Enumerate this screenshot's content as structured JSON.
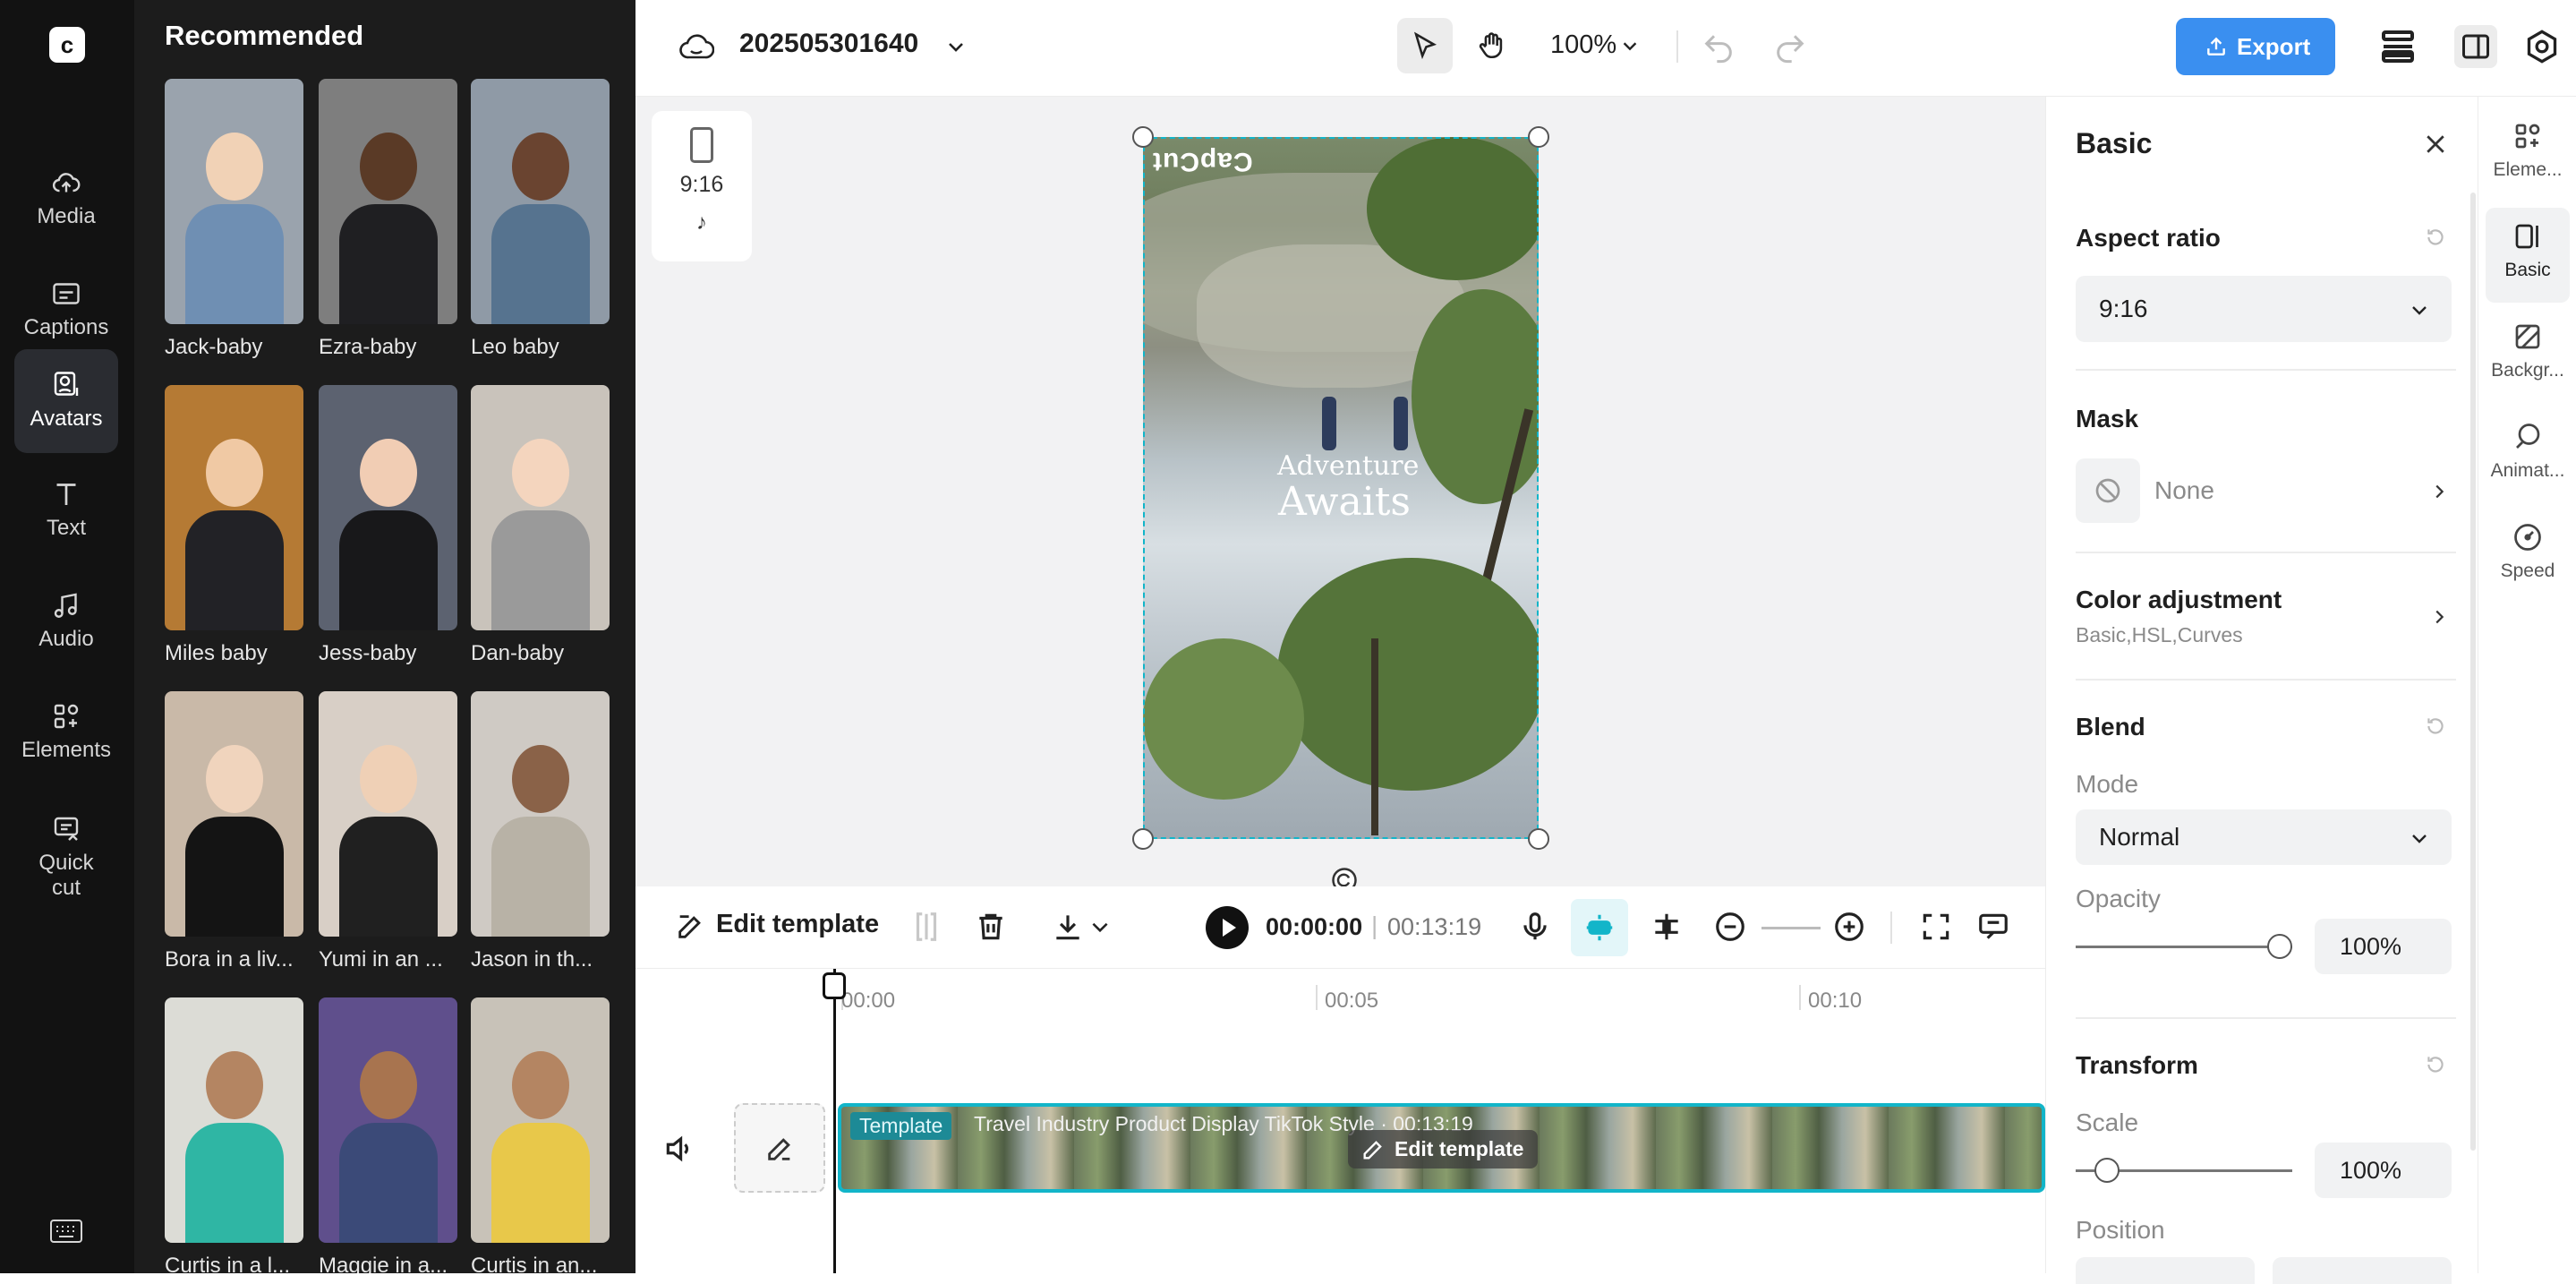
{
  "sidebar": {
    "items": [
      {
        "label": "Media",
        "icon": "cloud-upload-icon"
      },
      {
        "label": "Captions",
        "icon": "captions-icon"
      },
      {
        "label": "Avatars",
        "icon": "avatar-icon"
      },
      {
        "label": "Text",
        "icon": "text-icon"
      },
      {
        "label": "Audio",
        "icon": "music-note-icon"
      },
      {
        "label": "Elements",
        "icon": "elements-icon"
      },
      {
        "label": "Quick\ncut",
        "icon": "quick-cut-icon"
      }
    ],
    "active": "Avatars"
  },
  "panel": {
    "title": "Recommended",
    "avatars": [
      {
        "name": "Jack-baby",
        "bg": "#9aa3ad",
        "skin": "#f1d2b6",
        "cloth": "#6f8fb3"
      },
      {
        "name": "Ezra-baby",
        "bg": "#7e7e7e",
        "skin": "#5a3a26",
        "cloth": "#1f1f22"
      },
      {
        "name": "Leo baby",
        "bg": "#8f9aa6",
        "skin": "#6a4430",
        "cloth": "#56738f"
      },
      {
        "name": "Miles baby",
        "bg": "#b57a34",
        "skin": "#f0c9a4",
        "cloth": "#222226"
      },
      {
        "name": "Jess-baby",
        "bg": "#5c6270",
        "skin": "#f1cdb4",
        "cloth": "#18181a"
      },
      {
        "name": "Dan-baby",
        "bg": "#c9c3bb",
        "skin": "#f4d5be",
        "cloth": "#9a9a9a"
      },
      {
        "name": "Bora in a liv...",
        "bg": "#c9b9a8",
        "skin": "#f0d4bd",
        "cloth": "#141414"
      },
      {
        "name": "Yumi in an ...",
        "bg": "#d8cfc6",
        "skin": "#efd0b6",
        "cloth": "#202020"
      },
      {
        "name": "Jason in th...",
        "bg": "#cfcac4",
        "skin": "#8a6248",
        "cloth": "#b8b2a6"
      },
      {
        "name": "Curtis in a l...",
        "bg": "#dcdcd6",
        "skin": "#b48562",
        "cloth": "#2fb6a4"
      },
      {
        "name": "Maggie in a...",
        "bg": "#5f4f8c",
        "skin": "#a8744f",
        "cloth": "#3b4a78"
      },
      {
        "name": "Curtis in an...",
        "bg": "#c8c2b8",
        "skin": "#b48562",
        "cloth": "#e8c84a"
      }
    ]
  },
  "topbar": {
    "project_name": "202505301640",
    "zoom": "100%",
    "export_label": "Export",
    "accent": "#3a8ff0"
  },
  "canvas": {
    "ratio_label": "9:16",
    "logo_text": "CapCut",
    "title_line1": "Adventure",
    "title_line2": "Awaits"
  },
  "timeline_toolbar": {
    "edit_template_label": "Edit template",
    "current_time": "00:00:00",
    "separator": "|",
    "total_time": "00:13:19"
  },
  "timeline": {
    "ruler": [
      "00:00",
      "00:05",
      "00:10"
    ],
    "clip_tag": "Template",
    "clip_title": "Travel Industry Product Display TikTok Style · 00:13:19",
    "clip_edit_label": "Edit template",
    "selection_color": "#12b5c9"
  },
  "properties": {
    "title": "Basic",
    "aspect_ratio": {
      "label": "Aspect ratio",
      "value": "9:16"
    },
    "mask": {
      "label": "Mask",
      "value": "None"
    },
    "color_adjustment": {
      "label": "Color adjustment",
      "sub": "Basic,HSL,Curves"
    },
    "blend": {
      "label": "Blend",
      "mode_label": "Mode",
      "mode_value": "Normal",
      "opacity_label": "Opacity",
      "opacity_value": "100%",
      "opacity_fraction": 1.0
    },
    "transform": {
      "label": "Transform",
      "scale_label": "Scale",
      "scale_value": "100%",
      "scale_fraction": 0.1,
      "position_label": "Position"
    }
  },
  "tabs": [
    {
      "label": "Eleme...",
      "icon": "elements-icon"
    },
    {
      "label": "Basic",
      "icon": "basic-icon"
    },
    {
      "label": "Backgr...",
      "icon": "background-icon"
    },
    {
      "label": "Animat...",
      "icon": "animation-icon"
    },
    {
      "label": "Speed",
      "icon": "speed-icon"
    }
  ]
}
